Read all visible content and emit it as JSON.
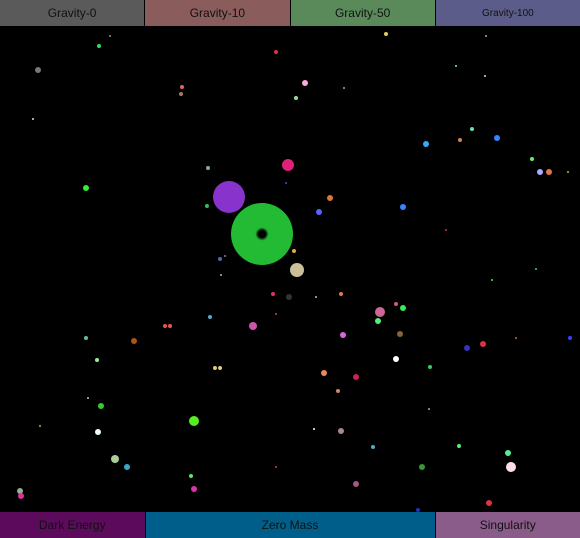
{
  "top_bar": {
    "buttons": [
      {
        "label": "Gravity-0",
        "color": "#5a5a5a"
      },
      {
        "label": "Gravity-10",
        "color": "#8a5c5c"
      },
      {
        "label": "Gravity-50",
        "color": "#5a8a5a"
      },
      {
        "label": "Gravity-100",
        "color": "#5c5c8a"
      }
    ]
  },
  "bottom_bar": {
    "buttons": [
      {
        "label": "Dark Energy",
        "color": "#5c0a5c"
      },
      {
        "label": "Zero Mass",
        "color": "#005f8a"
      },
      {
        "label": "Singularity",
        "color": "#8a5c8a"
      }
    ]
  },
  "scene": {
    "background": "#000000",
    "black_hole": {
      "body_color": "#22bb33",
      "core_color": "#000000"
    }
  }
}
